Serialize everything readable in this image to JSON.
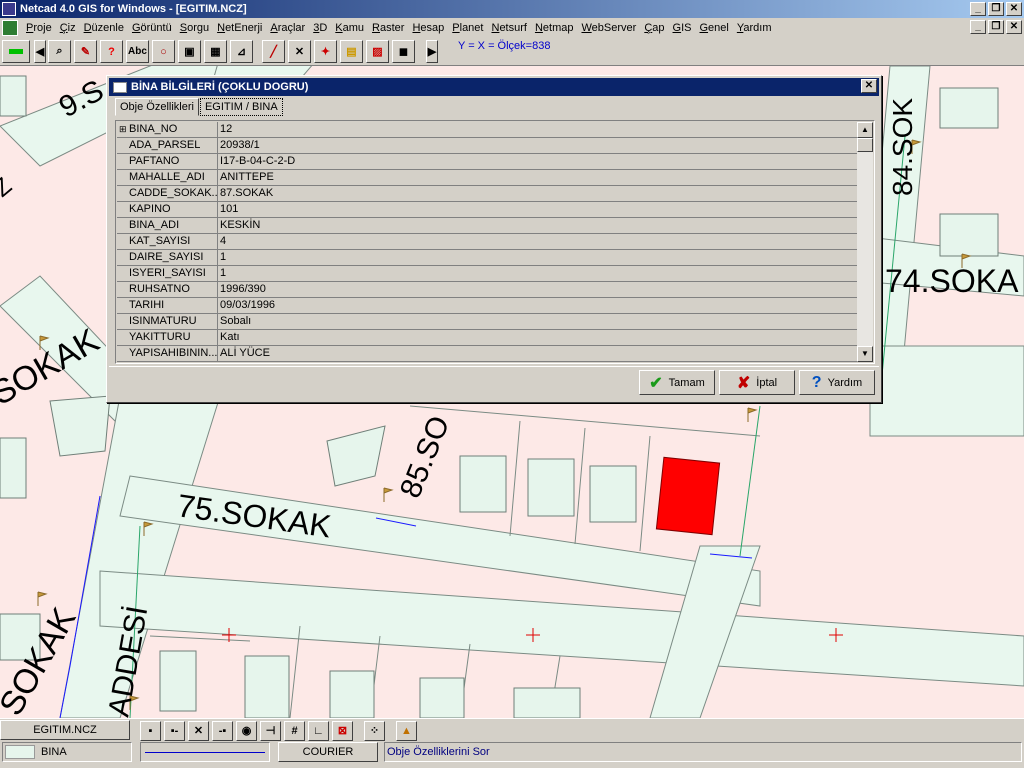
{
  "window": {
    "title": "Netcad 4.0 GIS for Windows - [EGITIM.NCZ]"
  },
  "menu": [
    "Proje",
    "Çiz",
    "Düzenle",
    "Görüntü",
    "Sorgu",
    "NetEnerji",
    "Araçlar",
    "3D",
    "Kamu",
    "Raster",
    "Hesap",
    "Planet",
    "Netsurf",
    "Netmap",
    "WebServer",
    "Çap",
    "GIS",
    "Genel",
    "Yardım"
  ],
  "toolbar": {
    "coords": "Y =   X =  Ölçek=838",
    "tools": [
      "binoculars-icon",
      "pen-icon",
      "help-icon",
      "text-icon",
      "circle-icon",
      "frame-icon",
      "building-icon",
      "dimension-icon",
      "line-icon",
      "intersect-icon",
      "layers-icon",
      "grid-icon",
      "hatch-icon",
      "solid-icon"
    ]
  },
  "map": {
    "labels": [
      "9.S",
      "84.SOK",
      "74.SOKA",
      "SOKAK",
      "85.SO",
      "75.SOKAK",
      "SOKAK",
      "ADDESİ",
      "Z"
    ]
  },
  "dialog": {
    "title": "BİNA BİLGİLERİ (ÇOKLU DOGRU)",
    "tabs": [
      "Obje Özellikleri",
      "EGITIM / BINA"
    ],
    "rows": [
      {
        "key": "BINA_NO",
        "value": "12"
      },
      {
        "key": "ADA_PARSEL",
        "value": "20938/1"
      },
      {
        "key": "PAFTANO",
        "value": "I17-B-04-C-2-D"
      },
      {
        "key": "MAHALLE_ADI",
        "value": "ANITTEPE"
      },
      {
        "key": "CADDE_SOKAK...",
        "value": "87.SOKAK"
      },
      {
        "key": "KAPINO",
        "value": "101"
      },
      {
        "key": "BINA_ADI",
        "value": "KESKİN"
      },
      {
        "key": "KAT_SAYISI",
        "value": "4"
      },
      {
        "key": "DAIRE_SAYISI",
        "value": "1"
      },
      {
        "key": "ISYERI_SAYISI",
        "value": "1"
      },
      {
        "key": "RUHSATNO",
        "value": "1996/390"
      },
      {
        "key": "TARIHI",
        "value": "09/03/1996"
      },
      {
        "key": "ISINMATURU",
        "value": "Sobalı"
      },
      {
        "key": "YAKITTURU",
        "value": "Katı"
      },
      {
        "key": "YAPISAHIBININ...",
        "value": "ALİ YÜCE"
      }
    ],
    "buttons": {
      "ok": "Tamam",
      "cancel": "İptal",
      "help": "Yardım"
    }
  },
  "status": {
    "file": "EGITIM.NCZ",
    "layer": "BINA",
    "font": "COURIER",
    "message": "Obje Özelliklerini Sor"
  },
  "colors": {
    "title": "#0a246a",
    "selected_building": "#ff0000",
    "building": "#e6f5ec",
    "road": "#e8f7ee"
  }
}
